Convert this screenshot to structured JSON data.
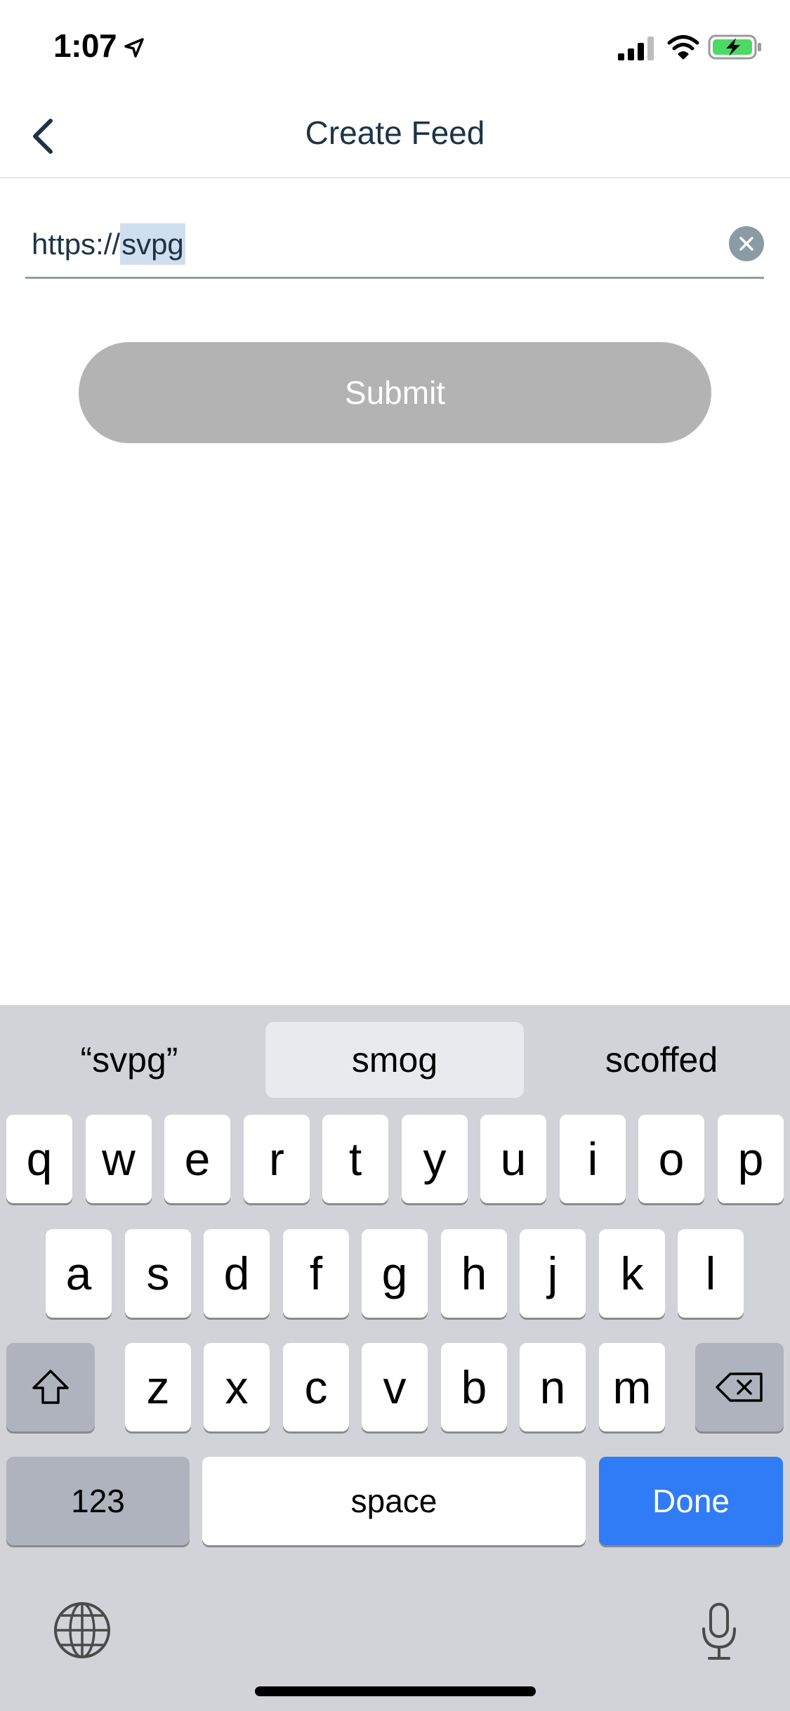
{
  "status_bar": {
    "time": "1:07"
  },
  "nav": {
    "title": "Create Feed"
  },
  "url_field": {
    "prefix": "https://",
    "selected": "svpg"
  },
  "submit": {
    "label": "Submit"
  },
  "keyboard": {
    "suggestions": [
      "“svpg”",
      "smog",
      "scoffed"
    ],
    "row1": [
      "q",
      "w",
      "e",
      "r",
      "t",
      "y",
      "u",
      "i",
      "o",
      "p"
    ],
    "row2": [
      "a",
      "s",
      "d",
      "f",
      "g",
      "h",
      "j",
      "k",
      "l"
    ],
    "row3": [
      "z",
      "x",
      "c",
      "v",
      "b",
      "n",
      "m"
    ],
    "numbers_label": "123",
    "space_label": "space",
    "done_label": "Done"
  },
  "colors": {
    "accent": "#2f7cf6",
    "title": "#1e3345",
    "disabled_button": "#b3b3b3"
  }
}
